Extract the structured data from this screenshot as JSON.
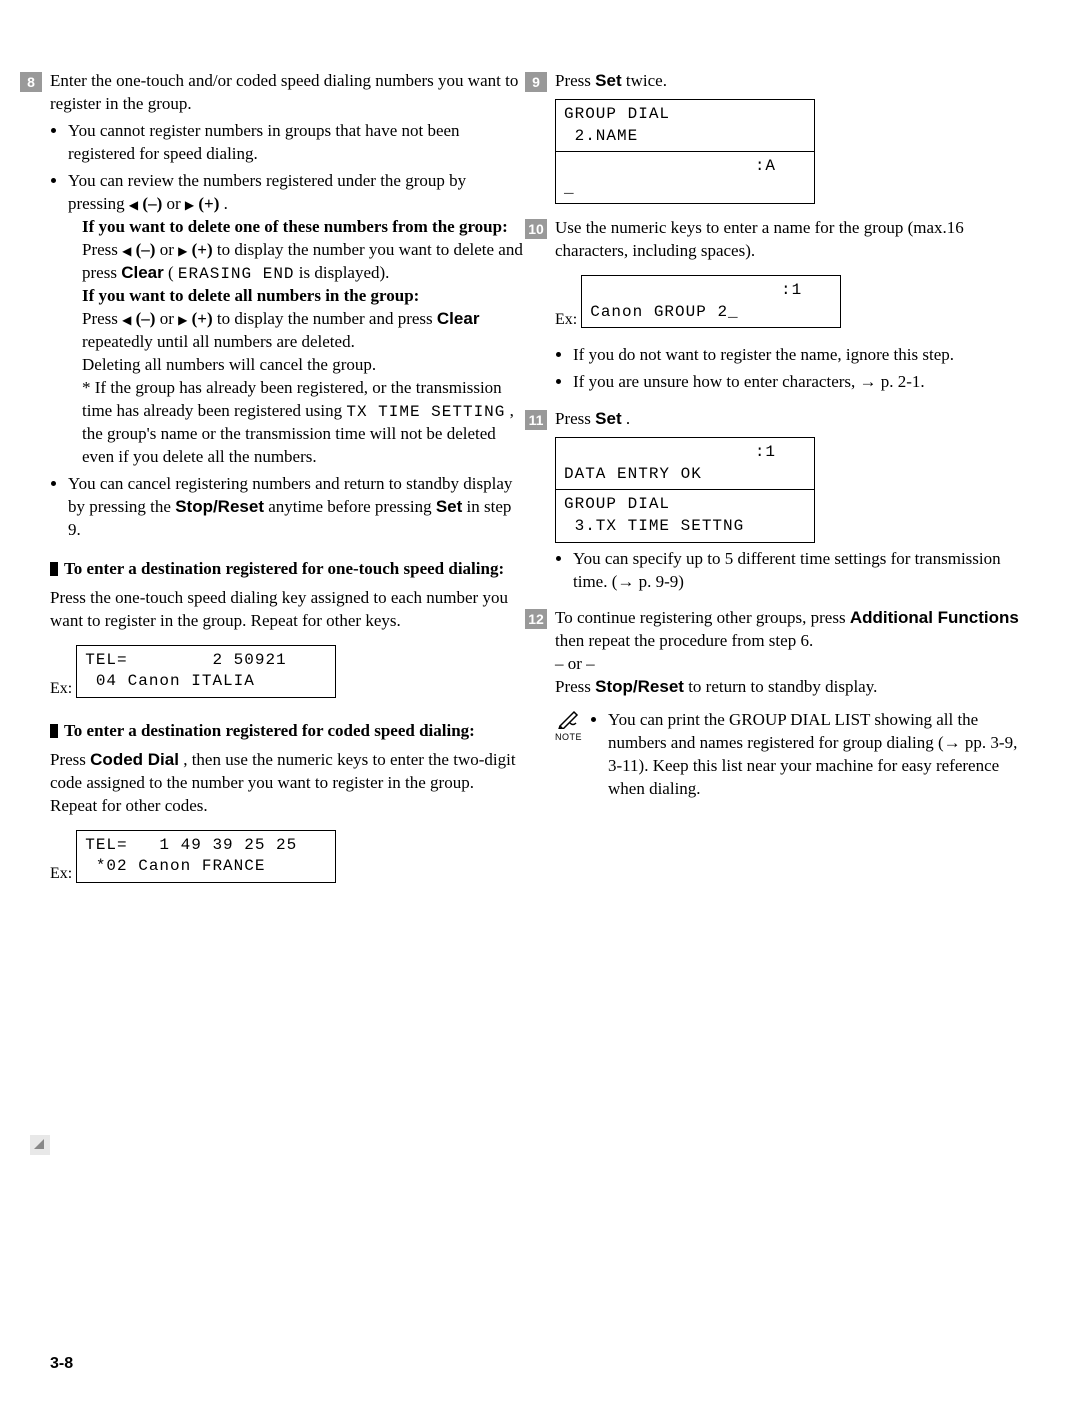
{
  "left": {
    "step8": {
      "num": "8",
      "intro": "Enter the one-touch and/or coded speed dialing numbers you want to register in the group.",
      "b1": "You cannot register numbers in groups that have not been registered for speed dialing.",
      "b2_pre": "You can review the numbers registered under the group by pressing ",
      "b2_minus": "(–)",
      "b2_or": " or ",
      "b2_plus": "(+)",
      "b2_end": ".",
      "del_one_head": "If you want to delete one of these numbers from the group:",
      "del_one_body_a": "Press ",
      "del_one_body_b": " or ",
      "del_one_body_c": " to display the number you want to delete and press ",
      "clear": "Clear",
      "del_one_body_d": " (",
      "erasing_end": "ERASING END",
      "del_one_body_e": " is displayed).",
      "del_all_head": "If you want to delete all numbers in the group:",
      "del_all_a": "Press ",
      "del_all_b": " or ",
      "del_all_c": " to display the number and press ",
      "del_all_d": " repeatedly until all numbers are deleted.",
      "del_all_note": "Deleting all numbers will cancel the group.",
      "star_note_a": "* If the group has already been registered, or the transmission time has already been registered using ",
      "tx_time": "TX TIME SETTING",
      "star_note_b": ", the group's name or the transmission time will not be deleted even if you delete all the numbers.",
      "b3_a": "You can cancel registering numbers and return to standby display by pressing the ",
      "stop_reset": "Stop/Reset",
      "b3_b": " anytime before pressing ",
      "set": "Set",
      "b3_c": " in step 9."
    },
    "one_touch": {
      "head": "To enter a destination registered for one-touch speed dialing:",
      "body": "Press the one-touch speed dialing key assigned to each number you want to register in the group. Repeat for other keys.",
      "ex": "Ex:",
      "lcd": "TEL=        2 50921\n 04 Canon ITALIA"
    },
    "coded": {
      "head": "To enter a destination registered for coded speed dialing:",
      "body_a": "Press ",
      "coded_dial": "Coded Dial",
      "body_b": ", then use the numeric keys to enter the two-digit code assigned to the number you want to register in the group. Repeat for other codes.",
      "ex": "Ex:",
      "lcd": "TEL=   1 49 39 25 25\n *02 Canon FRANCE"
    }
  },
  "right": {
    "step9": {
      "num": "9",
      "text_a": "Press ",
      "set": "Set",
      "text_b": " twice.",
      "lcd1": "GROUP DIAL\n 2.NAME",
      "lcd2": "                  :A\n_"
    },
    "step10": {
      "num": "10",
      "text": "Use the numeric keys to enter a name for the group (max.16 characters, including spaces).",
      "ex": "Ex:",
      "lcd": "                  :1\nCanon GROUP 2_",
      "b1": "If you do not want to register the name, ignore this step.",
      "b2": "If you are unsure how to enter characters, → p. 2-1."
    },
    "step11": {
      "num": "11",
      "text_a": "Press ",
      "set": "Set",
      "text_b": ".",
      "lcd1": "                  :1\nDATA ENTRY OK",
      "lcd2": "GROUP DIAL\n 3.TX TIME SETTNG",
      "b1": "You can specify up to 5 different time settings for transmission time. (→ p. 9-9)"
    },
    "step12": {
      "num": "12",
      "a": "To continue registering other groups, press ",
      "af": "Additional Functions",
      "b": " then repeat the procedure from step 6.",
      "or": "– or –",
      "c": "Press ",
      "sr": "Stop/Reset",
      "d": " to return to standby display.",
      "note_label": "NOTE",
      "note": "You can print the GROUP DIAL LIST showing all the numbers and names registered for group dialing (→ pp. 3-9, 3-11). Keep this list near your machine for easy reference when dialing."
    }
  },
  "page_num": "3-8"
}
